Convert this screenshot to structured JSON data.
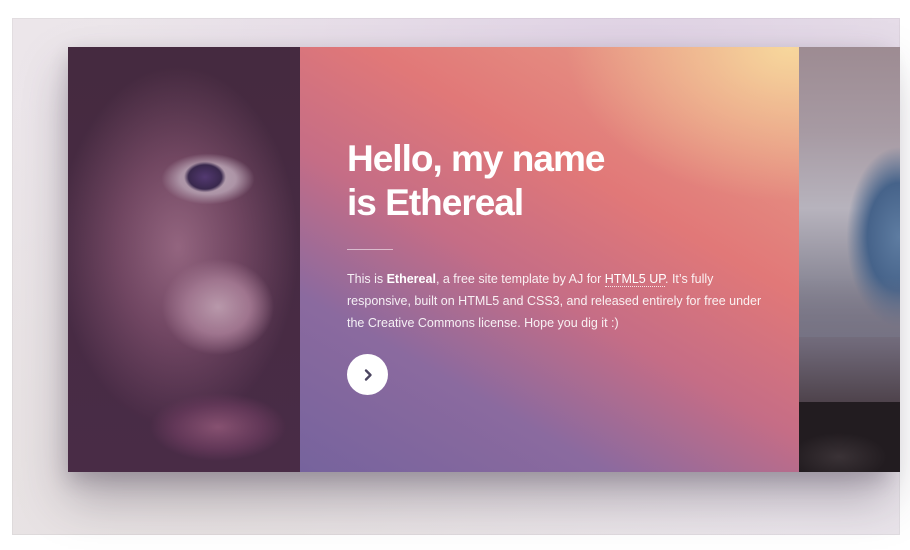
{
  "hero": {
    "title_line1": "Hello, my name",
    "title_line2": "is Ethereal",
    "text_before": "This is ",
    "text_bold": "Ethereal",
    "text_mid": ", a free site template by AJ for ",
    "link_label": "HTML5 UP",
    "text_after": ". It’s fully responsive, built on HTML5 and CSS3, and released entirely for free under the Creative Commons license. Hope you dig it :)",
    "next_icon": "chevron-right-icon"
  },
  "colors": {
    "gradient_top_right": "#f7d79c",
    "gradient_mid": "#e17878",
    "gradient_bottom_left": "#76639d",
    "button_bg": "#ffffff",
    "button_icon": "#4b4560"
  }
}
